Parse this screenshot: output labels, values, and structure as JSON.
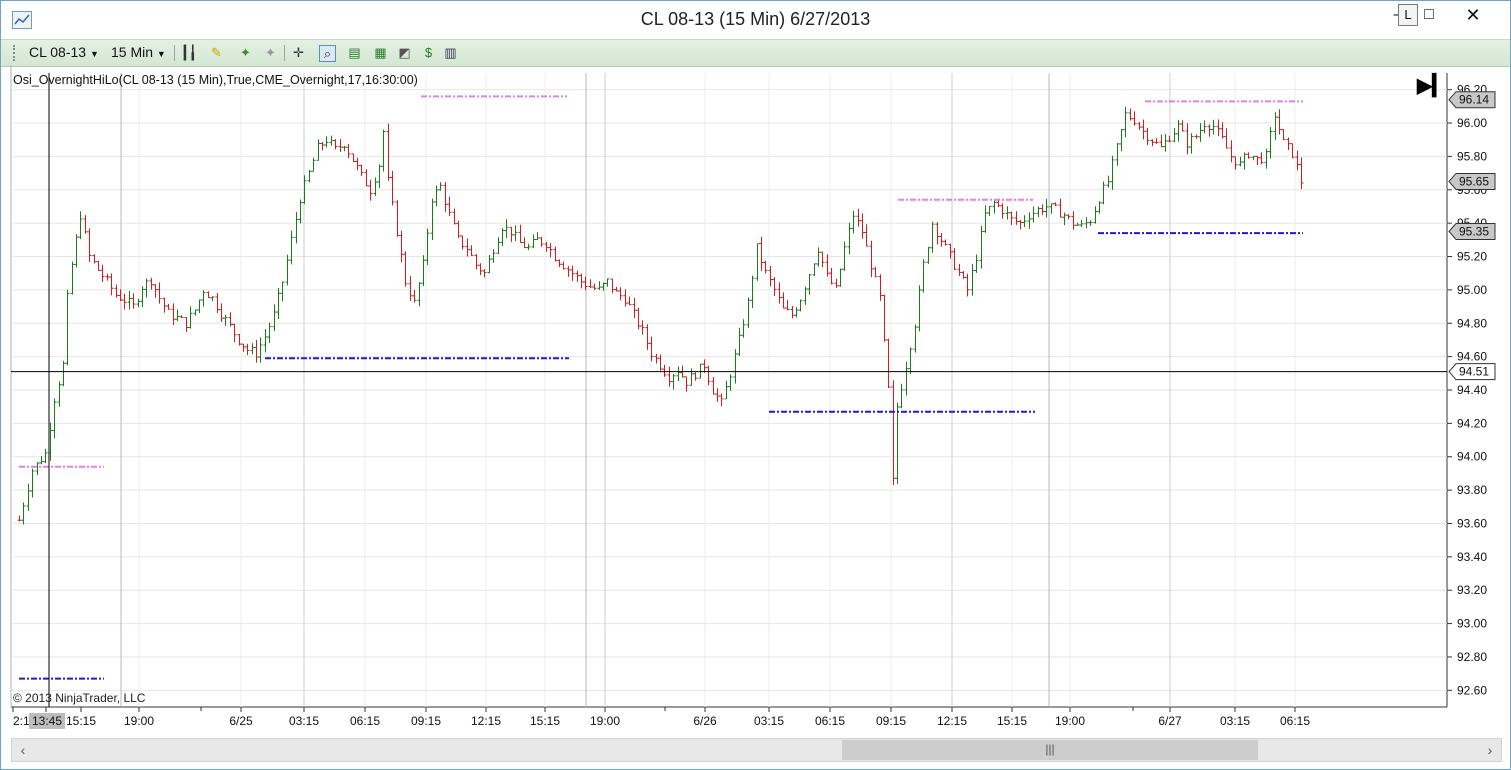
{
  "window": {
    "title": "CL 08-13 (15 Min)  6/27/2013",
    "minimize": "–",
    "link_label": "L",
    "maximize": "□",
    "close": "✕"
  },
  "toolbar": {
    "instrument": "CL 08-13",
    "interval": "15 Min",
    "icons": [
      "bar-type-icon",
      "pencil-icon",
      "magic-wand-icon",
      "wand-gray-icon",
      "crosshair-icon",
      "zoom-icon",
      "strategy-icon",
      "indicator-icon",
      "chart-style-icon",
      "money-icon",
      "properties-icon"
    ]
  },
  "indicator_label": "Osi_OvernightHiLo(CL  08-13  (15  Min),True,CME_Overnight,17,16:30:00)",
  "copyright": "© 2013 NinjaTrader, LLC",
  "chart_data": {
    "type": "candlestick",
    "y_axis": {
      "min": 92.5,
      "max": 96.3,
      "ticks": [
        "96.20",
        "96.00",
        "95.80",
        "95.60",
        "95.40",
        "95.20",
        "95.00",
        "94.80",
        "94.60",
        "94.40",
        "94.20",
        "94.00",
        "93.80",
        "93.60",
        "93.40",
        "93.20",
        "93.00",
        "92.80",
        "92.60"
      ]
    },
    "x_axis_labels": [
      "2:1",
      "13:45",
      "15:15",
      "19:00",
      "6/25",
      "03:15",
      "06:15",
      "09:15",
      "12:15",
      "15:15",
      "19:00",
      "6/26",
      "03:15",
      "06:15",
      "09:15",
      "12:15",
      "15:15",
      "19:00",
      "6/27",
      "03:15",
      "06:15"
    ],
    "cursor": {
      "time": "13:45",
      "price": "94.51"
    },
    "price_markers": [
      {
        "label": "96.14",
        "value": 96.14
      },
      {
        "label": "95.65",
        "value": 95.65
      },
      {
        "label": "95.35",
        "value": 95.35
      },
      {
        "label": "94.51",
        "value": 94.51
      }
    ],
    "overnight_high_lines": [
      {
        "value": 93.94,
        "from": "15:15",
        "to": "19:00"
      },
      {
        "value": 96.16,
        "from": "09:15",
        "to": "19:00"
      },
      {
        "value": 95.54,
        "from": "09:15",
        "to": "19:00"
      },
      {
        "value": 96.13,
        "from": "6/27",
        "to": "06:15"
      }
    ],
    "overnight_low_lines": [
      {
        "value": 92.67,
        "from": "15:15",
        "to": "19:00"
      },
      {
        "value": 94.59,
        "from": "6/25",
        "to": "19:00"
      },
      {
        "value": 94.27,
        "from": "03:15",
        "to": "19:00"
      },
      {
        "value": 95.34,
        "from": "19:00",
        "to": "06:15"
      }
    ],
    "path": [
      [
        0,
        93.62
      ],
      [
        3,
        93.92
      ],
      [
        6,
        94.02
      ],
      [
        8,
        94.35
      ],
      [
        10,
        94.55
      ],
      [
        11,
        94.95
      ],
      [
        12,
        95.15
      ],
      [
        14,
        95.45
      ],
      [
        16,
        95.2
      ],
      [
        18,
        95.12
      ],
      [
        20,
        95.05
      ],
      [
        22,
        94.97
      ],
      [
        24,
        94.94
      ],
      [
        26,
        94.9
      ],
      [
        28,
        95.02
      ],
      [
        30,
        95.06
      ],
      [
        32,
        94.95
      ],
      [
        34,
        94.86
      ],
      [
        36,
        94.83
      ],
      [
        38,
        94.8
      ],
      [
        40,
        94.88
      ],
      [
        42,
        95.0
      ],
      [
        44,
        94.95
      ],
      [
        46,
        94.86
      ],
      [
        48,
        94.78
      ],
      [
        50,
        94.7
      ],
      [
        52,
        94.64
      ],
      [
        54,
        94.62
      ],
      [
        56,
        94.72
      ],
      [
        58,
        94.85
      ],
      [
        60,
        95.05
      ],
      [
        62,
        95.3
      ],
      [
        64,
        95.55
      ],
      [
        66,
        95.7
      ],
      [
        68,
        95.85
      ],
      [
        70,
        95.9
      ],
      [
        72,
        95.84
      ],
      [
        74,
        95.88
      ],
      [
        76,
        95.78
      ],
      [
        78,
        95.68
      ],
      [
        80,
        95.6
      ],
      [
        82,
        95.75
      ],
      [
        83,
        95.95
      ],
      [
        84,
        95.65
      ],
      [
        86,
        95.35
      ],
      [
        88,
        95.05
      ],
      [
        90,
        94.92
      ],
      [
        92,
        95.15
      ],
      [
        94,
        95.55
      ],
      [
        96,
        95.62
      ],
      [
        98,
        95.45
      ],
      [
        100,
        95.3
      ],
      [
        102,
        95.25
      ],
      [
        104,
        95.15
      ],
      [
        106,
        95.1
      ],
      [
        108,
        95.25
      ],
      [
        110,
        95.38
      ],
      [
        112,
        95.35
      ],
      [
        114,
        95.28
      ],
      [
        116,
        95.25
      ],
      [
        118,
        95.3
      ],
      [
        120,
        95.28
      ],
      [
        122,
        95.2
      ],
      [
        124,
        95.15
      ],
      [
        126,
        95.1
      ],
      [
        128,
        95.05
      ],
      [
        130,
        95.02
      ],
      [
        132,
        95.0
      ],
      [
        134,
        95.05
      ],
      [
        136,
        94.98
      ],
      [
        138,
        94.95
      ],
      [
        140,
        94.85
      ],
      [
        142,
        94.75
      ],
      [
        144,
        94.62
      ],
      [
        146,
        94.55
      ],
      [
        148,
        94.48
      ],
      [
        150,
        94.52
      ],
      [
        152,
        94.45
      ],
      [
        154,
        94.5
      ],
      [
        156,
        94.55
      ],
      [
        158,
        94.4
      ],
      [
        160,
        94.32
      ],
      [
        162,
        94.5
      ],
      [
        164,
        94.7
      ],
      [
        166,
        94.92
      ],
      [
        168,
        95.25
      ],
      [
        170,
        95.1
      ],
      [
        172,
        95.0
      ],
      [
        174,
        94.88
      ],
      [
        176,
        94.85
      ],
      [
        178,
        94.95
      ],
      [
        180,
        95.1
      ],
      [
        182,
        95.25
      ],
      [
        184,
        95.08
      ],
      [
        186,
        95.0
      ],
      [
        188,
        95.25
      ],
      [
        190,
        95.45
      ],
      [
        192,
        95.35
      ],
      [
        194,
        95.15
      ],
      [
        196,
        94.95
      ],
      [
        198,
        94.4
      ],
      [
        199,
        93.85
      ],
      [
        200,
        94.3
      ],
      [
        202,
        94.55
      ],
      [
        204,
        94.8
      ],
      [
        206,
        95.15
      ],
      [
        208,
        95.4
      ],
      [
        210,
        95.3
      ],
      [
        212,
        95.2
      ],
      [
        214,
        95.1
      ],
      [
        216,
        95.0
      ],
      [
        218,
        95.2
      ],
      [
        220,
        95.45
      ],
      [
        222,
        95.52
      ],
      [
        224,
        95.48
      ],
      [
        226,
        95.42
      ],
      [
        228,
        95.4
      ],
      [
        230,
        95.45
      ],
      [
        232,
        95.48
      ],
      [
        234,
        95.5
      ],
      [
        236,
        95.48
      ],
      [
        238,
        95.45
      ],
      [
        240,
        95.4
      ],
      [
        242,
        95.38
      ],
      [
        244,
        95.42
      ],
      [
        246,
        95.55
      ],
      [
        248,
        95.65
      ],
      [
        250,
        95.85
      ],
      [
        252,
        96.05
      ],
      [
        254,
        96.02
      ],
      [
        256,
        95.95
      ],
      [
        258,
        95.9
      ],
      [
        260,
        95.85
      ],
      [
        262,
        95.92
      ],
      [
        264,
        95.98
      ],
      [
        266,
        95.88
      ],
      [
        268,
        95.92
      ],
      [
        270,
        96.0
      ],
      [
        272,
        95.98
      ],
      [
        274,
        95.9
      ],
      [
        276,
        95.8
      ],
      [
        278,
        95.75
      ],
      [
        280,
        95.82
      ],
      [
        282,
        95.78
      ],
      [
        284,
        95.8
      ],
      [
        286,
        96.05
      ],
      [
        288,
        95.88
      ],
      [
        290,
        95.82
      ],
      [
        292,
        95.65
      ]
    ]
  },
  "scrollbar": {
    "left_arrow": "‹",
    "right_arrow": "›",
    "grip": "|||"
  }
}
